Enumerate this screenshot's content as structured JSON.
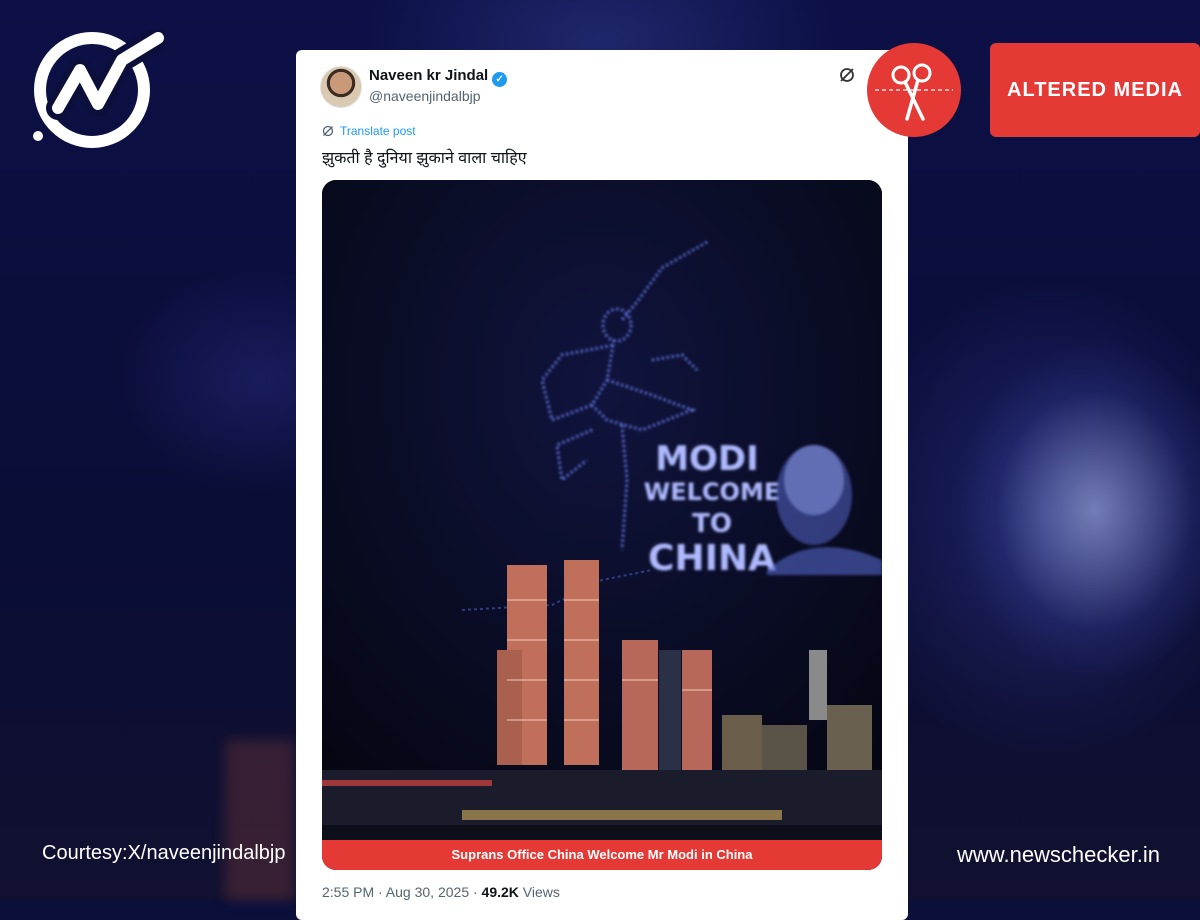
{
  "tweet": {
    "author_name": "Naveen kr Jindal",
    "author_handle": "@naveenjindalbjp",
    "translate_label": "Translate post",
    "text": "झुकती है दुनिया झुकाने वाला चाहिए",
    "media": {
      "drone_text_lines": [
        "MODI",
        "WELCOME",
        "TO",
        "CHINA"
      ],
      "caption": "Suprans Office China Welcome Mr Modi in China"
    },
    "timestamp": "2:55 PM · Aug 30, 2025 ·",
    "views_count": "49.2K",
    "views_label": "Views"
  },
  "badge": {
    "label": "ALTERED MEDIA",
    "icon": "scissors-icon",
    "color": "#e53935"
  },
  "footer": {
    "courtesy": "Courtesy:X/naveenjindalbjp",
    "site": "www.newschecker.in"
  },
  "logo": {
    "icon": "newschecker-logo-icon"
  },
  "colors": {
    "accent": "#e53935",
    "background": "#0b0f3a",
    "verified": "#1d9bf0"
  }
}
